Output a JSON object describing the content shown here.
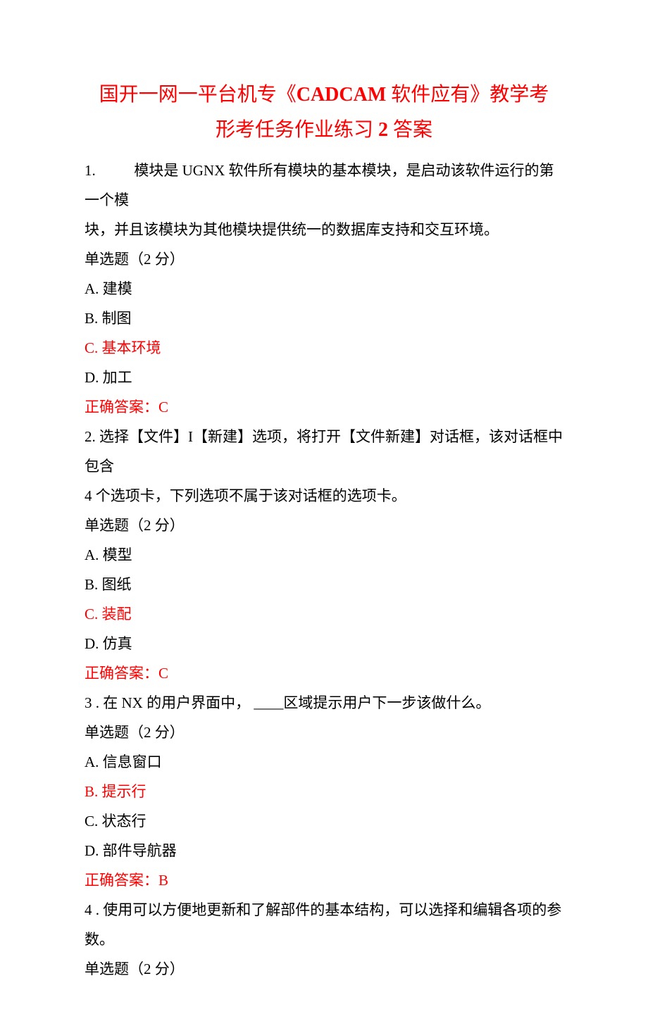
{
  "title": {
    "pre": "国开一网一平台机专《",
    "latin": "CADCAM",
    "mid": " 软件应有》教学考",
    "line2a": "形考任务作业练习 ",
    "digit": "2",
    "line2b": " 答案"
  },
  "q1": {
    "num": "1.",
    "text1": "模块是 UGNX 软件所有模块的基本模块，是启动该软件运行的第一个模",
    "text2": "块，并且该模块为其他模块提供统一的数据库支持和交互环境。",
    "meta": "单选题（2 分）",
    "a": "A. 建模",
    "b": "B. 制图",
    "c": "C. 基本环境",
    "d": "D. 加工",
    "ans": "正确答案：C"
  },
  "q2": {
    "line1": "2. 选择【文件】I【新建】选项，将打开【文件新建】对话框，该对话框中包含",
    "line2": "4 个选项卡，下列选项不属于该对话框的选项卡。",
    "meta": "单选题（2 分）",
    "a": "A. 模型",
    "b": "B. 图纸",
    "c": "C. 装配",
    "d": "D. 仿真",
    "ans": "正确答案：C"
  },
  "q3": {
    "line1": "3 . 在 NX 的用户界面中， ____区域提示用户下一步该做什么。",
    "meta": "单选题（2 分）",
    "a": "A. 信息窗口",
    "b": "B. 提示行",
    "c": "C. 状态行",
    "d": "D. 部件导航器",
    "ans": "正确答案：B"
  },
  "q4": {
    "line1": "4 . 使用可以方便地更新和了解部件的基本结构，可以选择和编辑各项的参",
    "line2": "数。",
    "meta": "单选题（2 分）"
  }
}
